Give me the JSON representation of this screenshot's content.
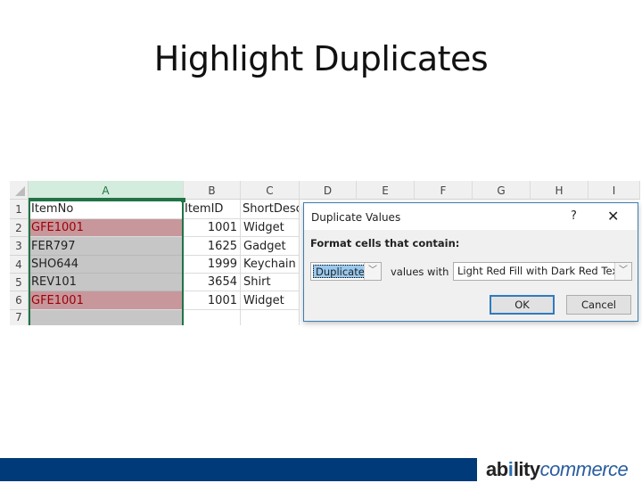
{
  "slide": {
    "title": "Highlight Duplicates"
  },
  "spreadsheet": {
    "columns": [
      "A",
      "B",
      "C",
      "D",
      "E",
      "F",
      "G",
      "H",
      "I"
    ],
    "selected_column": "A",
    "row_numbers": [
      "1",
      "2",
      "3",
      "4",
      "5",
      "6",
      "7"
    ],
    "header_row": {
      "item_no": "ItemNo",
      "item_id": "ItemID",
      "short_desc": "ShortDesc"
    },
    "rows": [
      {
        "item_no": "GFE1001",
        "item_id": "1001",
        "short_desc": "Widget",
        "duplicate": true
      },
      {
        "item_no": "FER797",
        "item_id": "1625",
        "short_desc": "Gadget",
        "duplicate": false
      },
      {
        "item_no": "SHO644",
        "item_id": "1999",
        "short_desc": "Keychain",
        "duplicate": false
      },
      {
        "item_no": "REV101",
        "item_id": "3654",
        "short_desc": "Shirt",
        "duplicate": false
      },
      {
        "item_no": "GFE1001",
        "item_id": "1001",
        "short_desc": "Widget",
        "duplicate": true
      }
    ],
    "colors": {
      "duplicate_fill": "#c7979c",
      "duplicate_text": "#9c0006",
      "selection": "#217346"
    }
  },
  "dialog": {
    "title": "Duplicate Values",
    "help_icon": "?",
    "close_icon": "✕",
    "prompt": "Format cells that contain:",
    "rule_type_value": "Duplicate",
    "middle_label": "values with",
    "format_value": "Light Red Fill with Dark Red Text",
    "ok_label": "OK",
    "cancel_label": "Cancel",
    "dropdown_icon": "﹀"
  },
  "footer": {
    "brand_part1": "ab",
    "brand_i": "i",
    "brand_part2": "lity",
    "brand_part3": "commerce",
    "bar_color": "#003a78"
  }
}
